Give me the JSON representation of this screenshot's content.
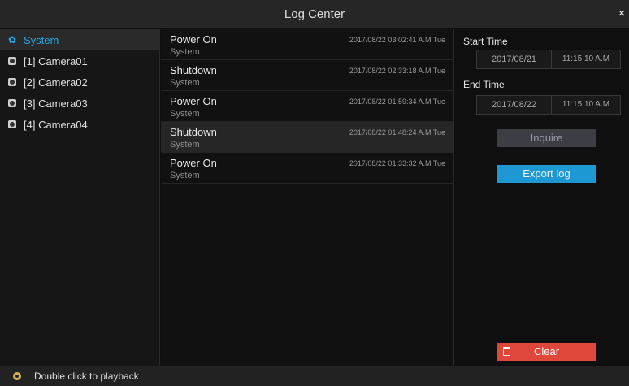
{
  "window": {
    "title": "Log Center",
    "close_icon": "×"
  },
  "sidebar": {
    "items": [
      {
        "label": "System",
        "icon": "gear-icon",
        "active": true
      },
      {
        "label": "[1] Camera01",
        "icon": "camera-icon"
      },
      {
        "label": "[2] Camera02",
        "icon": "camera-icon"
      },
      {
        "label": "[3] Camera03",
        "icon": "camera-icon"
      },
      {
        "label": "[4] Camera04",
        "icon": "camera-icon"
      }
    ]
  },
  "logs": [
    {
      "type": "Power On",
      "source": "System",
      "time": "2017/08/22 03:02:41 A.M Tue"
    },
    {
      "type": "Shutdown",
      "source": "System",
      "time": "2017/08/22 02:33:18 A.M Tue"
    },
    {
      "type": "Power On",
      "source": "System",
      "time": "2017/08/22 01:59:34 A.M Tue"
    },
    {
      "type": "Shutdown",
      "source": "System",
      "time": "2017/08/22 01:48:24 A.M Tue",
      "selected": true
    },
    {
      "type": "Power On",
      "source": "System",
      "time": "2017/08/22 01:33:32 A.M Tue"
    }
  ],
  "panel": {
    "start_label": "Start Time",
    "start_date": "2017/08/21",
    "start_time": "11:15:10 A.M",
    "end_label": "End Time",
    "end_date": "2017/08/22",
    "end_time": "11:15:10 A.M",
    "inquire_label": "Inquire",
    "export_label": "Export log",
    "clear_label": "Clear"
  },
  "status": {
    "text": "Double click to playback"
  },
  "colors": {
    "accent": "#2aa7e2",
    "export": "#1e98d3",
    "clear": "#e0473b"
  }
}
